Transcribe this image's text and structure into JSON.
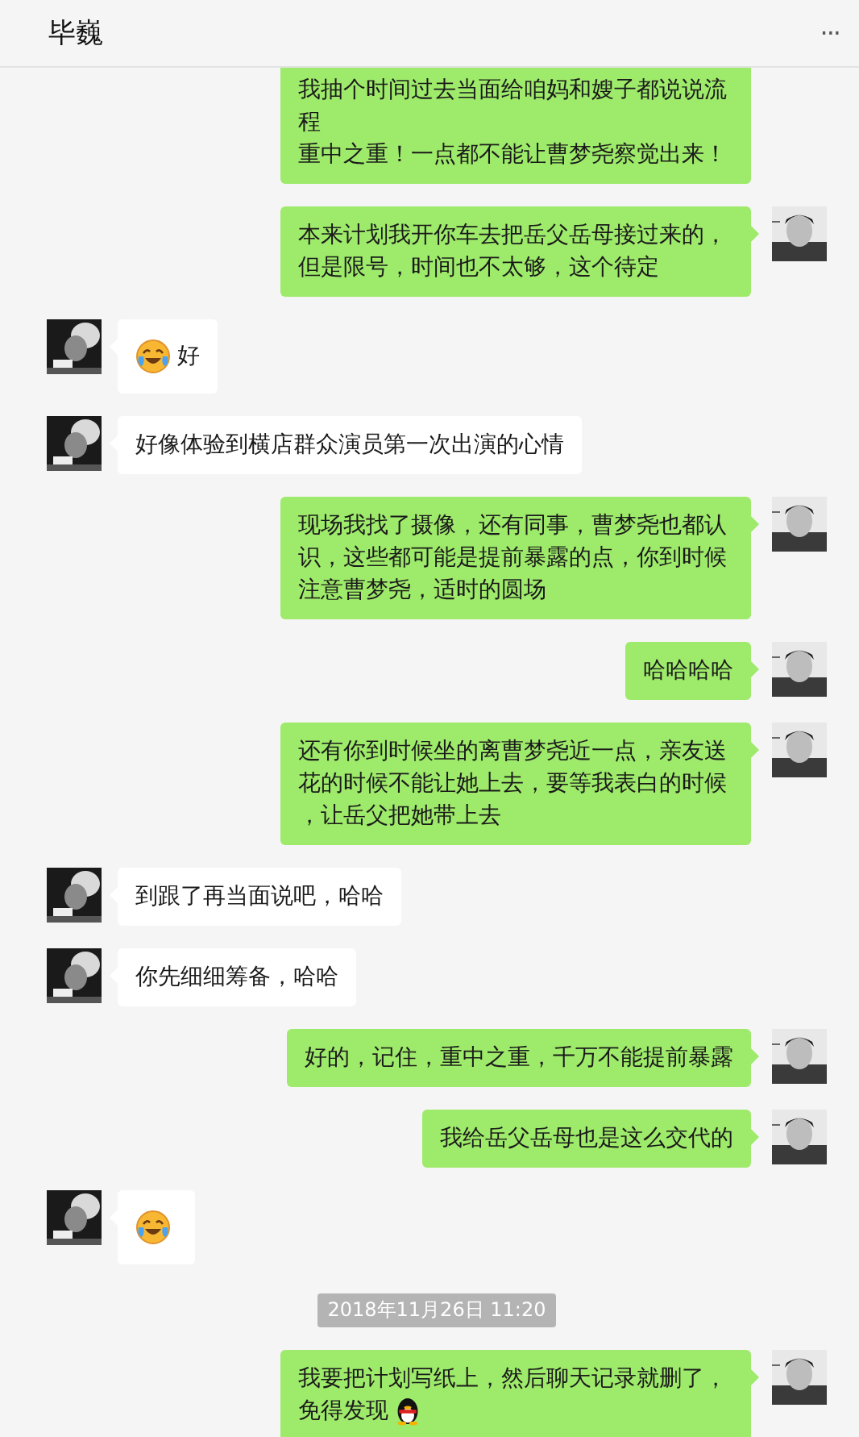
{
  "header": {
    "title": "毕巍",
    "menu": "···"
  },
  "messages": [
    {
      "kind": "message",
      "outgoing": true,
      "partial": true,
      "parts": [
        {
          "kind": "text",
          "text": "我抽个时间过去当面给咱妈和嫂子都说说流程"
        },
        {
          "kind": "text",
          "text": "重中之重！一点都不能让曹梦尧察觉出来！"
        }
      ]
    },
    {
      "kind": "message",
      "outgoing": true,
      "parts": [
        {
          "kind": "text",
          "text": "本来计划我开你车去把岳父岳母接过来的，但是限号，时间也不太够，这个待定"
        }
      ]
    },
    {
      "kind": "message",
      "outgoing": false,
      "parts": [
        {
          "kind": "emoji"
        },
        {
          "kind": "text",
          "text": "好"
        }
      ]
    },
    {
      "kind": "message",
      "outgoing": false,
      "parts": [
        {
          "kind": "text",
          "text": "好像体验到横店群众演员第一次出演的心情"
        }
      ]
    },
    {
      "kind": "message",
      "outgoing": true,
      "parts": [
        {
          "kind": "text",
          "text": "现场我找了摄像，还有同事，曹梦尧也都认识，这些都可能是提前暴露的点，你到时候注意曹梦尧，适时的圆场"
        }
      ]
    },
    {
      "kind": "message",
      "outgoing": true,
      "parts": [
        {
          "kind": "text",
          "text": "哈哈哈哈"
        }
      ]
    },
    {
      "kind": "message",
      "outgoing": true,
      "parts": [
        {
          "kind": "text",
          "text": "还有你到时候坐的离曹梦尧近一点，亲友送花的时候不能让她上去，要等我表白的时候，让岳父把她带上去"
        }
      ]
    },
    {
      "kind": "message",
      "outgoing": false,
      "parts": [
        {
          "kind": "text",
          "text": "到跟了再当面说吧，哈哈"
        }
      ]
    },
    {
      "kind": "message",
      "outgoing": false,
      "parts": [
        {
          "kind": "text",
          "text": "你先细细筹备，哈哈"
        }
      ]
    },
    {
      "kind": "message",
      "outgoing": true,
      "parts": [
        {
          "kind": "text",
          "text": "好的，记住，重中之重，千万不能提前暴露"
        }
      ]
    },
    {
      "kind": "message",
      "outgoing": true,
      "parts": [
        {
          "kind": "text",
          "text": "我给岳父岳母也是这么交代的"
        }
      ]
    },
    {
      "kind": "message",
      "outgoing": false,
      "parts": [
        {
          "kind": "emoji"
        }
      ]
    },
    {
      "kind": "time",
      "text": "2018年11月26日 11:20"
    },
    {
      "kind": "message",
      "outgoing": true,
      "parts": [
        {
          "kind": "text",
          "text": "我要把计划写纸上，然后聊天记录就删了，"
        },
        {
          "kind": "text",
          "text": "免得发现"
        },
        {
          "kind": "penguin"
        }
      ]
    }
  ]
}
